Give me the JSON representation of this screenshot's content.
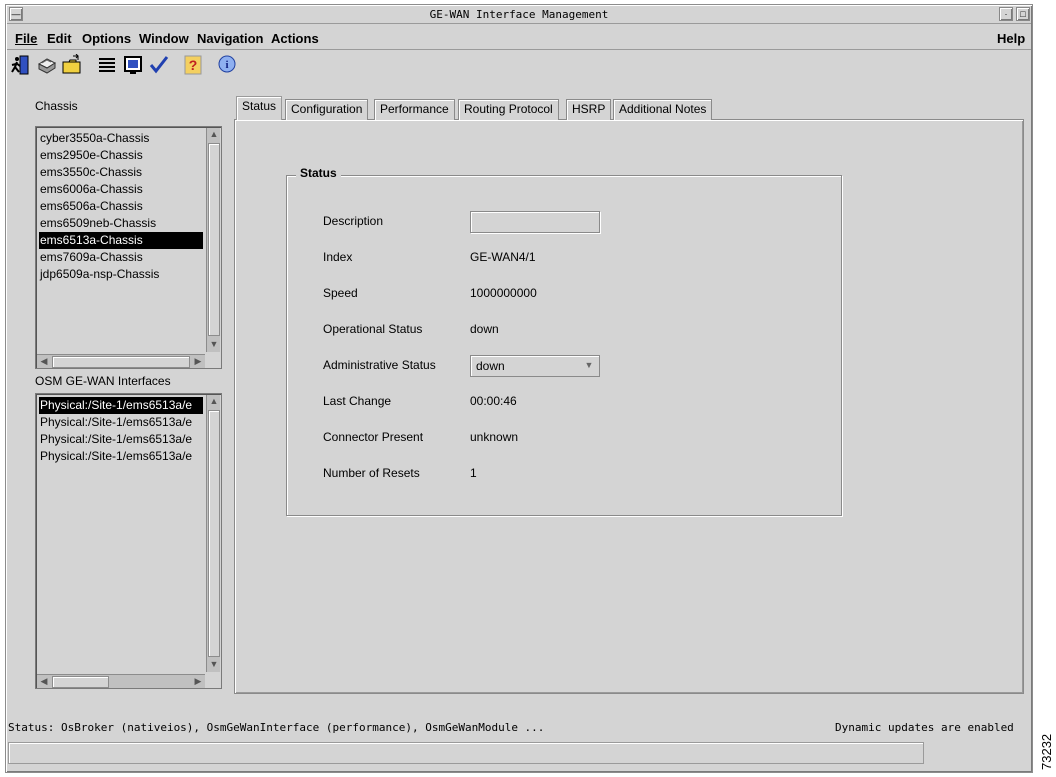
{
  "window": {
    "title": "GE-WAN Interface Management"
  },
  "menu": {
    "file": "File",
    "edit": "Edit",
    "options": "Options",
    "window": "Window",
    "navigation": "Navigation",
    "actions": "Actions",
    "help": "Help"
  },
  "chassis": {
    "label": "Chassis",
    "items": [
      "cyber3550a-Chassis",
      "ems2950e-Chassis",
      "ems3550c-Chassis",
      "ems6006a-Chassis",
      "ems6506a-Chassis",
      "ems6509neb-Chassis",
      "ems6513a-Chassis",
      "ems7609a-Chassis",
      "jdp6509a-nsp-Chassis"
    ],
    "selected": "ems6513a-Chassis"
  },
  "interfaces": {
    "label": "OSM GE-WAN Interfaces",
    "items": [
      "Physical:/Site-1/ems6513a/e",
      "Physical:/Site-1/ems6513a/e",
      "Physical:/Site-1/ems6513a/e",
      "Physical:/Site-1/ems6513a/e"
    ]
  },
  "tabs": [
    "Status",
    "Configuration",
    "Performance",
    "Routing Protocol",
    "HSRP",
    "Additional Notes"
  ],
  "status": {
    "group_title": "Status",
    "description_label": "Description",
    "description_value": "",
    "index_label": "Index",
    "index_value": "GE-WAN4/1",
    "speed_label": "Speed",
    "speed_value": "1000000000",
    "opstatus_label": "Operational Status",
    "opstatus_value": "down",
    "adminstatus_label": "Administrative Status",
    "adminstatus_value": "down",
    "lastchange_label": "Last Change",
    "lastchange_value": "00:00:46",
    "connector_label": "Connector Present",
    "connector_value": "unknown",
    "resets_label": "Number of Resets",
    "resets_value": "1"
  },
  "statusbar": {
    "text": "Status: OsBroker (nativeios), OsmGeWanInterface (performance), OsmGeWanModule  ...",
    "dynamic": "Dynamic updates are enabled"
  },
  "figure_id": "73232",
  "icons": [
    "exit-icon",
    "print-icon",
    "open-folder-icon",
    "list-icon",
    "screen-icon",
    "check-icon",
    "help-question-icon",
    "info-icon"
  ]
}
